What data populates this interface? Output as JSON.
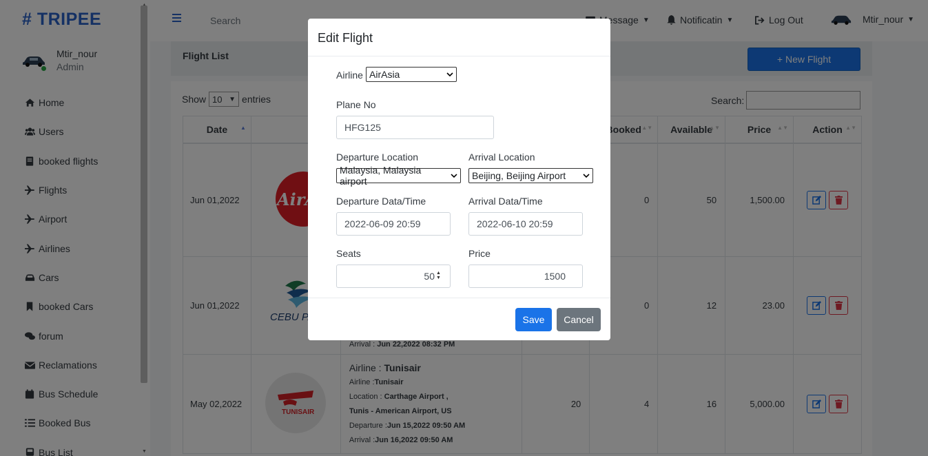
{
  "brand": "# TRIPEE",
  "user": {
    "name": "Mtir_nour",
    "role": "Admin"
  },
  "sidebar": {
    "items": [
      {
        "label": "Home",
        "icon": "home-icon"
      },
      {
        "label": "Users",
        "icon": "users-icon"
      },
      {
        "label": "booked flights",
        "icon": "book-icon"
      },
      {
        "label": "Flights",
        "icon": "plane-icon"
      },
      {
        "label": "Airport",
        "icon": "plane-icon"
      },
      {
        "label": "Airlines",
        "icon": "plane-icon"
      },
      {
        "label": "Cars",
        "icon": "car-icon"
      },
      {
        "label": "booked Cars",
        "icon": "bookmark-icon"
      },
      {
        "label": "forum",
        "icon": "comments-icon"
      },
      {
        "label": "Reclamations",
        "icon": "envelope-icon"
      },
      {
        "label": "Bus Schedule",
        "icon": "calendar-icon"
      },
      {
        "label": "Booked Bus",
        "icon": "list-icon"
      },
      {
        "label": "Bus List",
        "icon": "bus-icon"
      }
    ]
  },
  "topbar": {
    "search_placeholder": "Search",
    "message": "Message",
    "notification": "Notificatin",
    "logout": "Log Out",
    "user": "Mtir_nour"
  },
  "page": {
    "title": "Flight List",
    "new_button": "+ New Flight",
    "show_label": "Show",
    "entries_value": "10",
    "entries_label": "entries",
    "search_label": "Search:"
  },
  "table": {
    "headers": [
      "Date",
      "",
      "",
      "",
      "Booked",
      "Available",
      "Price",
      "Action"
    ],
    "rows": [
      {
        "date": "Jun 01,2022",
        "logo": "AirAsia",
        "booked": "0",
        "available": "50",
        "price": "1,500.00"
      },
      {
        "date": "Jun 01,2022",
        "logo": "CEBU PAC",
        "booked": "0",
        "available": "12",
        "price": "23.00",
        "partial": {
          "arrival_label": "Arrival :",
          "arrival": "Jun 22,2022 08:32 PM"
        }
      },
      {
        "date": "May 02,2022",
        "logo": "TUNISAIR",
        "seats": "20",
        "booked": "4",
        "available": "16",
        "price": "5,000.00",
        "info": {
          "airline_big_label": "Airline :",
          "airline_big": "Tunisair",
          "airline_label": "Airline :",
          "airline": "Tunisair",
          "location_label": "Location :",
          "location_1": "Carthage Airport ,",
          "location_2": "Tunis - American Airport, US",
          "departure_label": "Departure :",
          "departure": "Jun 15,2022 09:50 AM",
          "arrival_label": "Arrival :",
          "arrival": "Jun 16,2022 09:50 AM"
        }
      }
    ]
  },
  "modal": {
    "title": "Edit Flight",
    "airline_label": "Airline",
    "airline_value": "AirAsia",
    "plane_label": "Plane No",
    "plane_value": "HFG125",
    "departure_loc_label": "Departure Location",
    "departure_loc_value": "Malaysia, Malaysia airport",
    "arrival_loc_label": "Arrival Location",
    "arrival_loc_value": "Beijing, Beijing Airport",
    "departure_dt_label": "Departure Data/Time",
    "departure_dt_value": "2022-06-09 20:59",
    "arrival_dt_label": "Arrival Data/Time",
    "arrival_dt_value": "2022-06-10 20:59",
    "seats_label": "Seats",
    "seats_value": "50",
    "price_label": "Price",
    "price_value": "1500",
    "save": "Save",
    "cancel": "Cancel"
  },
  "colors": {
    "accent": "#1a73e8",
    "brand": "#2a62c9",
    "danger": "#dc3545",
    "secondary": "#6c757d"
  }
}
